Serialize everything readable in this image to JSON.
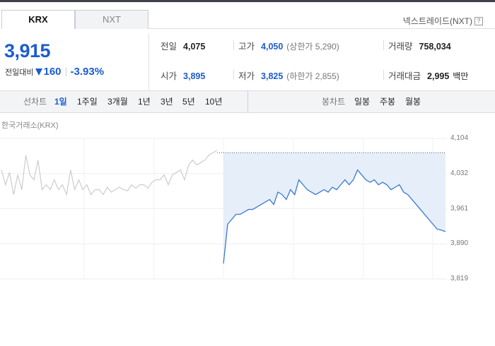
{
  "tabs": [
    "KRX",
    "NXT"
  ],
  "nxt_link": "넥스트레이드(NXT)",
  "price": "3,915",
  "change": {
    "label": "전일대비",
    "amount": "160",
    "percent": "-3.93%"
  },
  "stats": {
    "prev_close": {
      "label": "전일",
      "value": "4,075"
    },
    "high": {
      "label": "고가",
      "value": "4,050",
      "sub": "(상한가 5,290)"
    },
    "volume": {
      "label": "거래량",
      "value": "758,034"
    },
    "open": {
      "label": "시가",
      "value": "3,895"
    },
    "low": {
      "label": "저가",
      "value": "3,825",
      "sub": "(하한가 2,855)"
    },
    "amount": {
      "label": "거래대금",
      "value": "2,995",
      "unit": "백만"
    }
  },
  "toolbar": {
    "line_label": "선차트",
    "periods": [
      "1일",
      "1주일",
      "3개월",
      "1년",
      "3년",
      "5년",
      "10년"
    ],
    "selected_period": "1일",
    "candle_label": "봉차트",
    "candle_periods": [
      "일봉",
      "주봉",
      "월봉"
    ]
  },
  "exchange_label": "한국거래소(KRX)",
  "colors": {
    "accent": "#1c5ccf",
    "fill": "#e6eef9",
    "prev_line": "#cccccc",
    "line": "#3a78d4"
  },
  "chart_data": {
    "type": "line",
    "y_ticks": [
      "4,104",
      "4,032",
      "3,961",
      "3,890",
      "3,819"
    ],
    "ylim": [
      3819,
      4104
    ],
    "reference_level": 4075,
    "series": [
      {
        "values": [
          4040,
          4010,
          4035,
          3990,
          4030,
          4000,
          4070,
          4030,
          4020,
          4060,
          4000,
          4010,
          4000,
          4020,
          4000,
          4010,
          3990,
          4040,
          4000,
          4020,
          4000,
          4010,
          3990,
          4000,
          4000,
          3990,
          4005,
          3995,
          4000,
          4005,
          4000,
          3998,
          4010,
          4003,
          4010,
          4010,
          4003,
          4015,
          4020,
          4020,
          4030,
          4010,
          4030,
          4035,
          4040,
          4020,
          4050,
          4060,
          4050,
          4055,
          4060,
          4070,
          4075,
          4080
        ]
      },
      {
        "values": [
          3850,
          3930,
          3940,
          3950,
          3950,
          3955,
          3960,
          3960,
          3965,
          3970,
          3975,
          3980,
          3970,
          3995,
          3990,
          3980,
          4000,
          3990,
          4020,
          4010,
          4000,
          3995,
          3990,
          3995,
          4000,
          3995,
          4005,
          4000,
          4010,
          4020,
          4010,
          4020,
          4040,
          4030,
          4020,
          4015,
          4020,
          4010,
          4015,
          4010,
          4000,
          4005,
          4010,
          3995,
          3990,
          3980,
          3970,
          3960,
          3950,
          3940,
          3930,
          3920,
          3918,
          3915
        ]
      }
    ]
  }
}
